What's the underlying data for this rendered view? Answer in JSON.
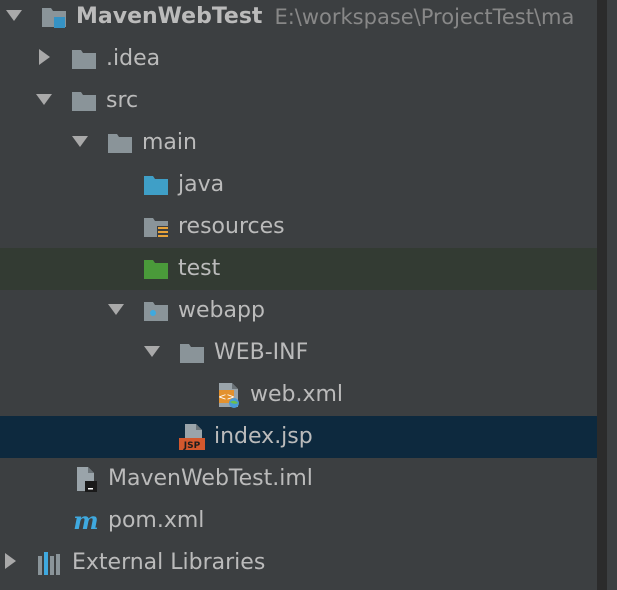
{
  "tree": {
    "root": {
      "label": "MavenWebTest",
      "path": "E:\\workspase\\ProjectTest\\ma"
    },
    "idea": {
      "label": ".idea"
    },
    "src": {
      "label": "src"
    },
    "main": {
      "label": "main"
    },
    "java": {
      "label": "java"
    },
    "resources": {
      "label": "resources"
    },
    "test": {
      "label": "test"
    },
    "webapp": {
      "label": "webapp"
    },
    "webinf": {
      "label": "WEB-INF"
    },
    "webxml": {
      "label": "web.xml"
    },
    "indexjsp": {
      "label": "index.jsp"
    },
    "iml": {
      "label": "MavenWebTest.iml"
    },
    "pom": {
      "label": "pom.xml"
    },
    "extlibs": {
      "label": "External Libraries"
    }
  },
  "colors": {
    "background": "#3c3f41",
    "selected_row": "#0d293e",
    "highlight_row": "#333b33",
    "text": "#bbbbbb",
    "folder": "#8a9499",
    "source_folder": "#3f9fc7",
    "test_folder": "#4a9a3a"
  }
}
